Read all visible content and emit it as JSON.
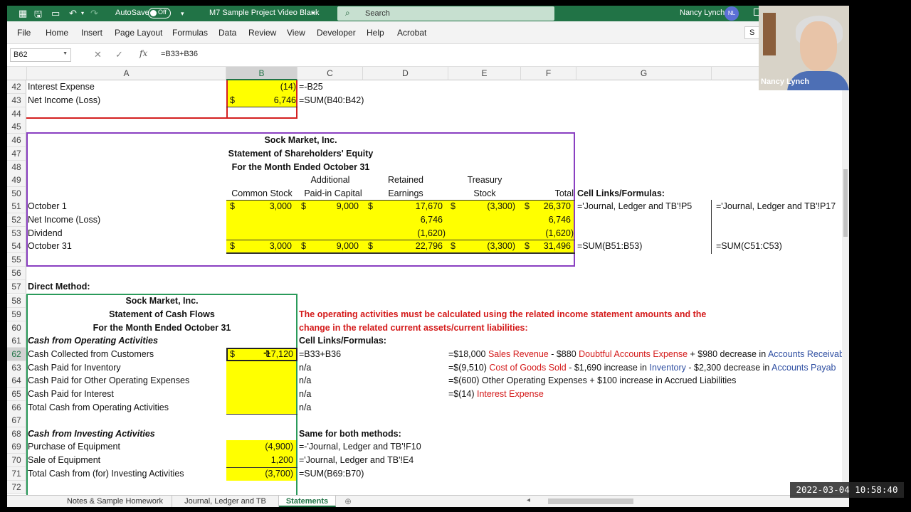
{
  "window": {
    "autosave_label": "AutoSave",
    "autosave_state": "Off",
    "document_title": "M7 Sample Project Video Blank",
    "search_placeholder": "Search",
    "user_name": "Nancy Lynch",
    "user_initials": "NL",
    "accent_color": "#217346"
  },
  "menu": [
    "File",
    "Home",
    "Insert",
    "Page Layout",
    "Formulas",
    "Data",
    "Review",
    "View",
    "Developer",
    "Help",
    "Acrobat"
  ],
  "share_label": "S",
  "formula_bar": {
    "name_box": "B62",
    "formula": "=B33+B36"
  },
  "columns": [
    "A",
    "B",
    "C",
    "D",
    "E",
    "F",
    "G"
  ],
  "rows": [
    {
      "n": "42",
      "cells": {
        "A": "Interest Expense",
        "B": "(14)",
        "C": "=-B25"
      }
    },
    {
      "n": "43",
      "cells": {
        "A": "Net Income (Loss)",
        "B_cur": "$",
        "B": "6,746",
        "C": "=SUM(B40:B42)"
      }
    },
    {
      "n": "44",
      "cells": {}
    },
    {
      "n": "45",
      "cells": {}
    },
    {
      "n": "46",
      "cells": {
        "title": "Sock Market, Inc."
      }
    },
    {
      "n": "47",
      "cells": {
        "title": "Statement of Shareholders' Equity"
      }
    },
    {
      "n": "48",
      "cells": {
        "title": "For the Month Ended October 31"
      }
    },
    {
      "n": "49",
      "cells": {
        "C": "Additional",
        "D": "Retained",
        "E": "Treasury"
      }
    },
    {
      "n": "50",
      "cells": {
        "B": "Common Stock",
        "C": "Paid-in Capital",
        "D": "Earnings",
        "E": "Stock",
        "F": "Total",
        "G": "Cell Links/Formulas:"
      }
    },
    {
      "n": "51",
      "cells": {
        "A": "October 1",
        "B_cur": "$",
        "B": "3,000",
        "C_cur": "$",
        "C": "9,000",
        "D_cur": "$",
        "D": "17,670",
        "E_cur": "$",
        "E": "(3,300)",
        "F_cur": "$",
        "F": "26,370",
        "G": "='Journal, Ledger and TB'!P5",
        "H": "='Journal, Ledger and TB'!P17"
      }
    },
    {
      "n": "52",
      "cells": {
        "A": "Net Income (Loss)",
        "D": "6,746",
        "F": "6,746"
      }
    },
    {
      "n": "53",
      "cells": {
        "A": "Dividend",
        "D": "(1,620)",
        "F": "(1,620)"
      }
    },
    {
      "n": "54",
      "cells": {
        "A": "October 31",
        "B_cur": "$",
        "B": "3,000",
        "C_cur": "$",
        "C": "9,000",
        "D_cur": "$",
        "D": "22,796",
        "E_cur": "$",
        "E": "(3,300)",
        "F_cur": "$",
        "F": "31,496",
        "G": "=SUM(B51:B53)",
        "H": "=SUM(C51:C53)"
      }
    },
    {
      "n": "55",
      "cells": {}
    },
    {
      "n": "56",
      "cells": {}
    },
    {
      "n": "57",
      "cells": {
        "A": "Direct Method:"
      }
    },
    {
      "n": "58",
      "cells": {
        "title": "Sock Market, Inc."
      }
    },
    {
      "n": "59",
      "cells": {
        "title": "Statement of Cash Flows",
        "note": "The operating activities must be calculated using the related income statement amounts and the"
      }
    },
    {
      "n": "60",
      "cells": {
        "title": "For the Month Ended October 31",
        "note": "change in the related current assets/current liabilities:"
      }
    },
    {
      "n": "61",
      "cells": {
        "A": "Cash from Operating Activities",
        "C": "Cell Links/Formulas:"
      }
    },
    {
      "n": "62",
      "cells": {
        "A": "Cash Collected from Customers",
        "B_cur": "$",
        "B": "17,120",
        "C": "=B33+B36"
      }
    },
    {
      "n": "63",
      "cells": {
        "A": "Cash Paid for Inventory",
        "C": "n/a"
      }
    },
    {
      "n": "64",
      "cells": {
        "A": "Cash Paid for Other Operating Expenses",
        "C": "n/a"
      }
    },
    {
      "n": "65",
      "cells": {
        "A": "Cash Paid for Interest",
        "C": "n/a"
      }
    },
    {
      "n": "66",
      "cells": {
        "A": "Total Cash from Operating Activities",
        "C": "n/a"
      }
    },
    {
      "n": "67",
      "cells": {}
    },
    {
      "n": "68",
      "cells": {
        "A": "Cash from Investing Activities",
        "C": "Same for both methods:"
      }
    },
    {
      "n": "69",
      "cells": {
        "A": "Purchase of Equipment",
        "B": "(4,900)",
        "C": "=-'Journal, Ledger and TB'!F10"
      }
    },
    {
      "n": "70",
      "cells": {
        "A": "Sale of Equipment",
        "B": "1,200",
        "C": "='Journal, Ledger and TB'!E4"
      }
    },
    {
      "n": "71",
      "cells": {
        "A": "Total Cash from (for) Investing Activities",
        "B": "(3,700)",
        "C": "=SUM(B69:B70)"
      }
    },
    {
      "n": "72",
      "cells": {}
    }
  ],
  "explanations": {
    "r62": [
      {
        "t": "=$18,000 ",
        "k": "plain"
      },
      {
        "t": "Sales Revenue",
        "k": "red"
      },
      {
        "t": " - $880 ",
        "k": "plain"
      },
      {
        "t": "Doubtful Accounts Expense",
        "k": "red"
      },
      {
        "t": " + $980 decrease in ",
        "k": "plain"
      },
      {
        "t": "Accounts Receivab",
        "k": "blue"
      }
    ],
    "r63": [
      {
        "t": "=$(9,510) ",
        "k": "plain"
      },
      {
        "t": "Cost of Goods Sold",
        "k": "red"
      },
      {
        "t": " - $1,690 increase in ",
        "k": "plain"
      },
      {
        "t": "Inventory",
        "k": "blue"
      },
      {
        "t": "  - $2,300 decrease in ",
        "k": "plain"
      },
      {
        "t": "Accounts Payab",
        "k": "blue"
      }
    ],
    "r64": [
      {
        "t": "=$(600) Other Operating Expenses + $100 increase in Accrued Liabilities",
        "k": "plain"
      }
    ],
    "r65": [
      {
        "t": "=$(14) ",
        "k": "plain"
      },
      {
        "t": "Interest Expense",
        "k": "red"
      }
    ]
  },
  "sheet_tabs": [
    "Notes & Sample Homework",
    "Journal, Ledger and TB",
    "Statements"
  ],
  "active_tab": "Statements",
  "webcam_label": "Nancy Lynch",
  "timestamp": "2022-03-04 10:58:40",
  "colors": {
    "highlight": "#ffff00",
    "red_box": "#d42020",
    "purple_box": "#8a3fc1",
    "green_box": "#2a9a5a",
    "note_red": "#d41a1a",
    "link_blue": "#2f4fa2"
  }
}
